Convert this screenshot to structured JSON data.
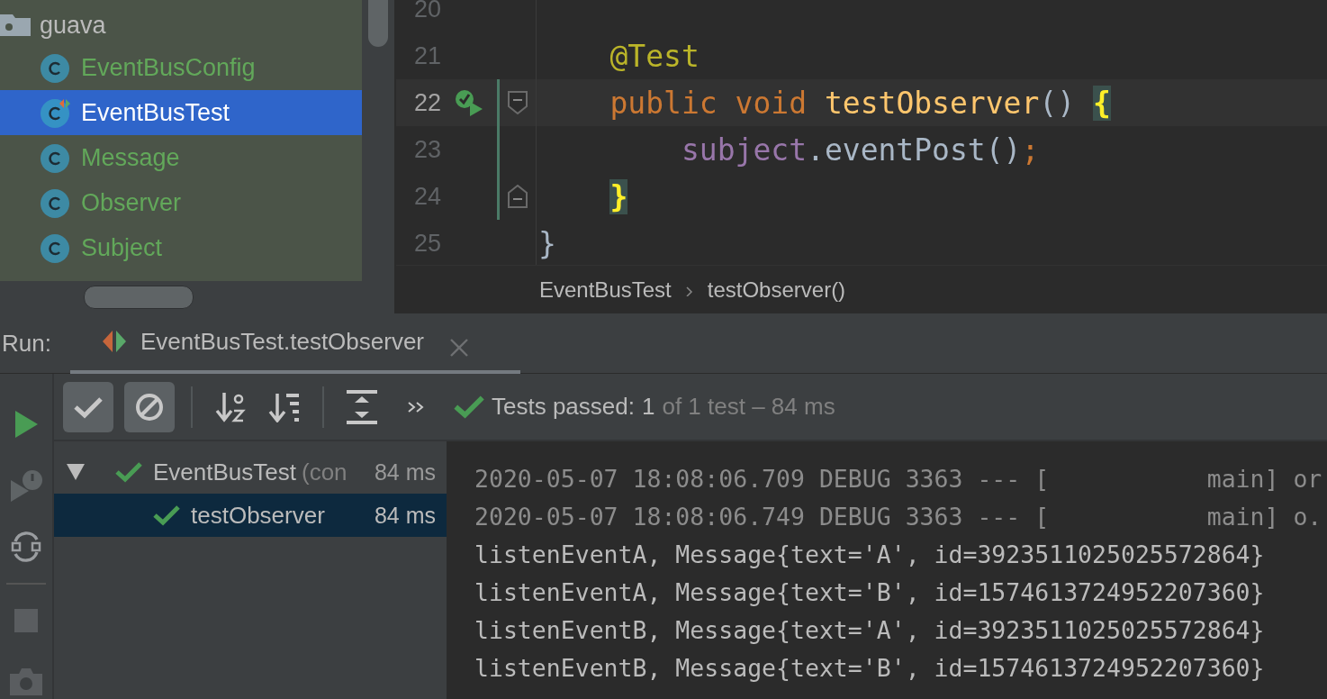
{
  "project_tree": {
    "folder": {
      "name": "guava",
      "expanded": true,
      "children": [
        {
          "name": "EventBusConfig",
          "kind": "class",
          "selected": false
        },
        {
          "name": "EventBusTest",
          "kind": "test-class",
          "selected": true
        },
        {
          "name": "Message",
          "kind": "class",
          "selected": false
        },
        {
          "name": "Observer",
          "kind": "class",
          "selected": false
        },
        {
          "name": "Subject",
          "kind": "class",
          "selected": false
        }
      ]
    }
  },
  "editor": {
    "lines": [
      {
        "number": "20",
        "current": false,
        "changed": false,
        "run_marker": false,
        "fold_start": false,
        "fold_end": false
      },
      {
        "number": "21",
        "current": false,
        "changed": false,
        "run_marker": false,
        "fold_start": false,
        "fold_end": false,
        "tokens": [
          {
            "text": "    @Test",
            "kind": "annotation"
          }
        ]
      },
      {
        "number": "22",
        "current": true,
        "changed": true,
        "run_marker": true,
        "fold_start": true,
        "fold_end": false,
        "tokens": [
          {
            "text": "    public void ",
            "kind": "keyword"
          },
          {
            "text": "testObserver",
            "kind": "method"
          },
          {
            "text": "() ",
            "kind": "plain"
          },
          {
            "text": "{",
            "kind": "brace-match"
          }
        ]
      },
      {
        "number": "23",
        "current": false,
        "changed": true,
        "run_marker": false,
        "fold_start": false,
        "fold_end": false,
        "tokens": [
          {
            "text": "        subject",
            "kind": "field"
          },
          {
            "text": ".eventPost()",
            "kind": "plain"
          },
          {
            "text": ";",
            "kind": "keyword"
          }
        ]
      },
      {
        "number": "24",
        "current": false,
        "changed": true,
        "run_marker": false,
        "fold_start": false,
        "fold_end": true,
        "tokens": [
          {
            "text": "    }",
            "kind": "brace-match"
          }
        ]
      },
      {
        "number": "25",
        "current": false,
        "changed": false,
        "run_marker": false,
        "fold_start": false,
        "fold_end": false,
        "tokens": [
          {
            "text": "}",
            "kind": "plain"
          }
        ]
      }
    ],
    "breadcrumbs": [
      "EventBusTest",
      "testObserver()"
    ]
  },
  "run_panel": {
    "label": "Run:",
    "tab": {
      "title": "EventBusTest.testObserver",
      "selected": true
    },
    "toggles": [
      {
        "selected": true
      },
      {
        "selected": true
      }
    ],
    "status": {
      "label": "Tests passed:",
      "count": "1",
      "detail": "of 1 test – 84 ms"
    },
    "tests": [
      {
        "name": "EventBusTest",
        "suffix": "(con",
        "duration": "84 ms",
        "expanded": true,
        "selected": false,
        "children": [
          {
            "name": "testObserver",
            "duration": "84 ms",
            "selected": true
          }
        ]
      }
    ],
    "console": [
      {
        "kind": "log",
        "text": "2020-05-07 18:08:06.709 DEBUG 3363 --- [           main] or"
      },
      {
        "kind": "log",
        "text": "2020-05-07 18:08:06.749 DEBUG 3363 --- [           main] o."
      },
      {
        "kind": "output",
        "text": "listenEventA, Message{text='A', id=3923511025025572864}"
      },
      {
        "kind": "output",
        "text": "listenEventA, Message{text='B', id=1574613724952207360}"
      },
      {
        "kind": "output",
        "text": "listenEventB, Message{text='A', id=3923511025025572864}"
      },
      {
        "kind": "output",
        "text": "listenEventB, Message{text='B', id=1574613724952207360}"
      }
    ]
  }
}
